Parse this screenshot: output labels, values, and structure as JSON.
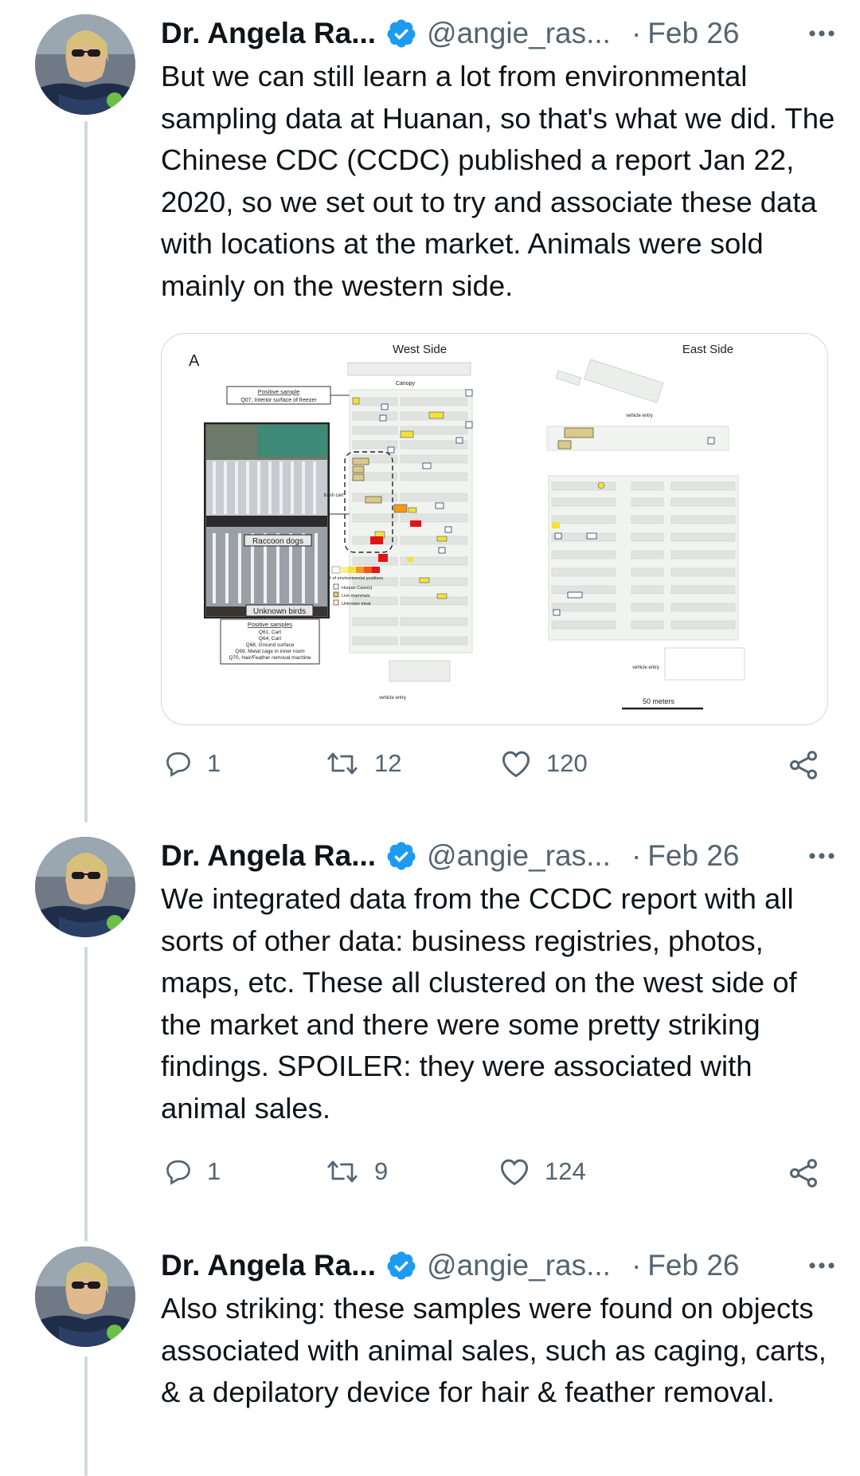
{
  "tweets": [
    {
      "author_name": "Dr. Angela Ra...",
      "handle": "@angie_ras...",
      "separator": "·",
      "date": "Feb 26",
      "text": "But we can still learn a lot from environmental sampling data at Huanan, so that's what we did. The Chinese CDC (CCDC) published a report Jan 22, 2020, so we set out to try and associate these data with locations at the market. Animals were sold mainly on the western side.",
      "replies": "1",
      "retweets": "12",
      "likes": "120"
    },
    {
      "author_name": "Dr. Angela Ra...",
      "handle": "@angie_ras...",
      "separator": "·",
      "date": "Feb 26",
      "text": "We integrated data from the CCDC report with all sorts of other data: business registries, photos, maps, etc. These all clustered on the west side of the market and there were some pretty striking findings. SPOILER: they were associated with animal sales.",
      "replies": "1",
      "retweets": "9",
      "likes": "124"
    },
    {
      "author_name": "Dr. Angela Ra...",
      "handle": "@angie_ras...",
      "separator": "·",
      "date": "Feb 26",
      "text": "Also striking: these samples were found on objects associated with animal sales, such as caging, carts, & a depilatory device for hair & feather removal."
    }
  ],
  "media": {
    "panel_label": "A",
    "west_label": "West Side",
    "east_label": "East Side",
    "canopy": "Canopy",
    "positive_sample_title": "Positive sample",
    "positive_sample_desc": "Q07, Interior surface of freezer",
    "raccoon_label": "Raccoon dogs",
    "birds_label": "Unknown birds",
    "positive_samples_title": "Positive samples",
    "positive_samples_list": [
      "Q61, Cart",
      "Q64, Cart",
      "Q68, Ground surface",
      "Q69, Metal cage in inner room",
      "Q70, Hair/Feather removal machine"
    ],
    "trash_cart": "trash cart",
    "legend_scale": [
      "0",
      "1",
      "2",
      "3",
      "4",
      "5"
    ],
    "legend_scale_label": "# of environmental positives",
    "legend_items": [
      "Human Case(s)",
      "Live mammals",
      "Unknown meat"
    ],
    "vehicle_entry": "vehicle entry",
    "scale_label": "50 meters"
  },
  "icons": {
    "reply": "reply-icon",
    "retweet": "retweet-icon",
    "like": "heart-icon",
    "share": "share-icon",
    "more": "more-icon",
    "verified": "verified-badge-icon"
  },
  "colors": {
    "accent": "#1d9bf0",
    "secondary_text": "#536471",
    "thread_line": "#cfd9de",
    "heat_yellow": "#f2e23a",
    "heat_orange": "#f29a1a",
    "heat_red": "#e01515"
  }
}
